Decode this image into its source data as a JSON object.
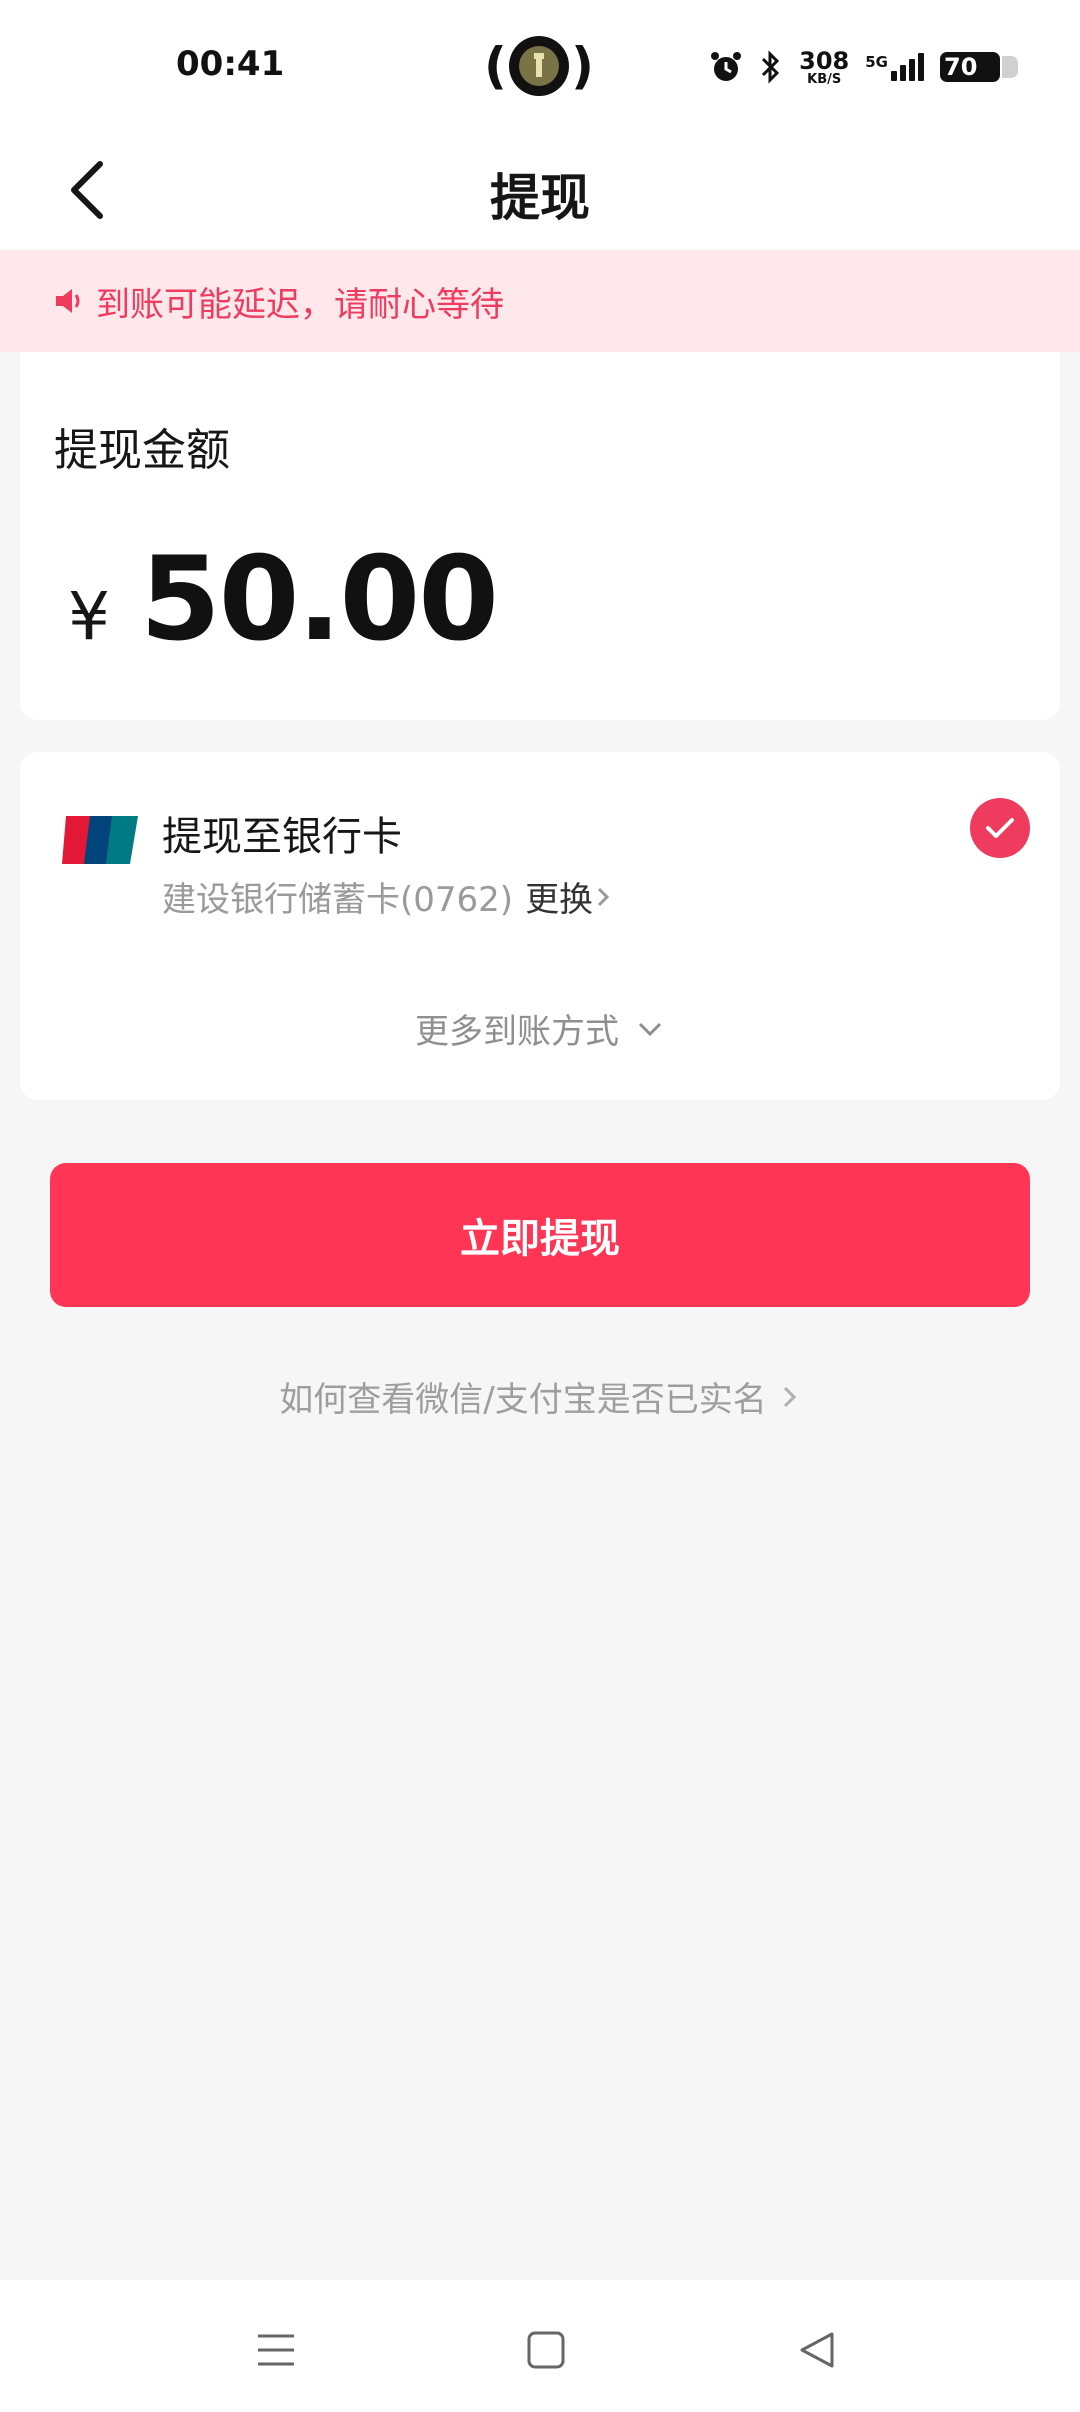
{
  "status_bar": {
    "time": "00:41",
    "network_speed": "308",
    "network_unit": "KB/S",
    "network_type": "5G",
    "battery": "70"
  },
  "header": {
    "title": "提现"
  },
  "notice": {
    "text": "到账可能延迟，请耐心等待"
  },
  "amount": {
    "label": "提现金额",
    "currency": "¥",
    "value": "50.00"
  },
  "method": {
    "title": "提现至银行卡",
    "card": "建设银行储蓄卡(0762)",
    "change_label": "更换",
    "more_label": "更多到账方式"
  },
  "actions": {
    "submit_label": "立即提现",
    "help_link": "如何查看微信/支付宝是否已实名"
  },
  "colors": {
    "accent": "#fe3555",
    "notice_bg": "#ffe8ec",
    "notice_text": "#ee3b5e"
  }
}
